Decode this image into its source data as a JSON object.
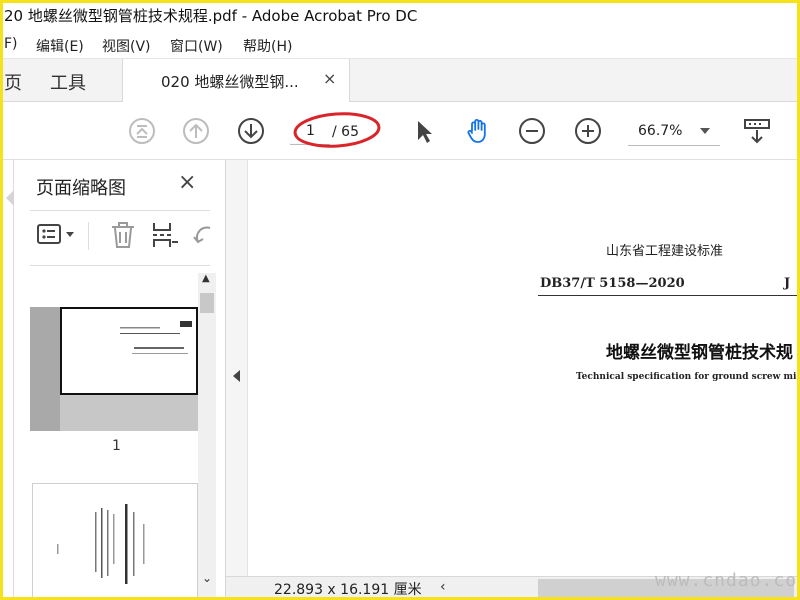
{
  "window": {
    "title": "20 地螺丝微型钢管桩技术规程.pdf - Adobe Acrobat Pro DC"
  },
  "menu": [
    "F)",
    "编辑(E)",
    "视图(V)",
    "窗口(W)",
    "帮助(H)"
  ],
  "tabs": {
    "home": "页",
    "tools": "工具",
    "document": "020 地螺丝微型钢...",
    "close": "×"
  },
  "toolbar": {
    "current_page": "1",
    "total_pages": "/ 65",
    "zoom": "66.7%"
  },
  "colors": {
    "annotation_red": "#d9252a",
    "hand_tool_blue": "#1473e6",
    "frame_yellow": "#f5e21b"
  },
  "thumbnail_panel": {
    "title": "页面缩略图",
    "close": "×",
    "thumbnails": [
      {
        "label": "1"
      }
    ]
  },
  "document": {
    "org": "山东省工程建设标准",
    "standard_no": "DB37/T 5158—2020",
    "standard_prefix": "J",
    "title_cn": "地螺丝微型钢管桩技术规",
    "title_en": "Technical specification for ground screw micro st"
  },
  "status": {
    "page_size": "22.893 x 16.191 厘米"
  },
  "watermark": "www.cndao.com"
}
